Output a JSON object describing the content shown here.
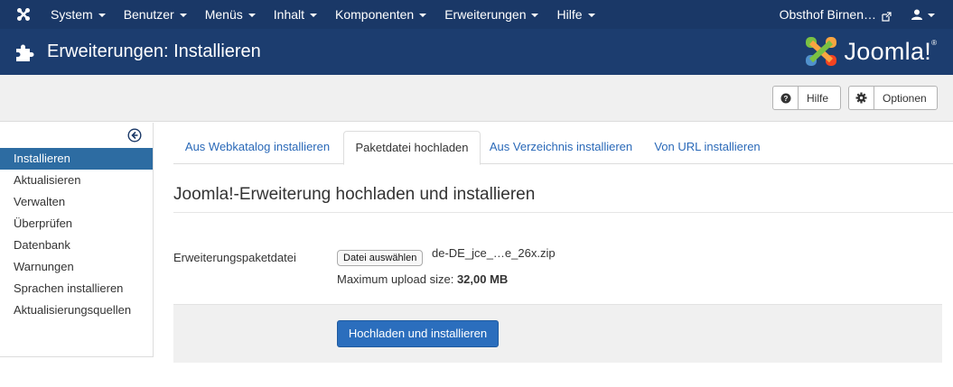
{
  "topnav": {
    "menu": [
      {
        "label": "System"
      },
      {
        "label": "Benutzer"
      },
      {
        "label": "Menüs"
      },
      {
        "label": "Inhalt"
      },
      {
        "label": "Komponenten"
      },
      {
        "label": "Erweiterungen"
      },
      {
        "label": "Hilfe"
      }
    ],
    "site_link": "Obsthof Birnen…",
    "bar_color": "#1a3867"
  },
  "header": {
    "title": "Erweiterungen: Installieren",
    "brand": "Joomla!",
    "brand_reg": "®",
    "bg_color": "#1c3d6f"
  },
  "toolbar": {
    "help_label": "Hilfe",
    "options_label": "Optionen"
  },
  "sidebar": {
    "items": [
      {
        "label": "Installieren",
        "active": true
      },
      {
        "label": "Aktualisieren"
      },
      {
        "label": "Verwalten"
      },
      {
        "label": "Überprüfen"
      },
      {
        "label": "Datenbank"
      },
      {
        "label": "Warnungen"
      },
      {
        "label": "Sprachen installieren"
      },
      {
        "label": "Aktualisierungsquellen"
      }
    ],
    "active_color": "#2d6ca2"
  },
  "tabs": [
    {
      "label": "Aus Webkatalog installieren"
    },
    {
      "label": "Paketdatei hochladen",
      "active": true
    },
    {
      "label": "Aus Verzeichnis installieren"
    },
    {
      "label": "Von URL installieren"
    }
  ],
  "main": {
    "legend": "Joomla!-Erweiterung hochladen und installieren",
    "field_label": "Erweiterungspaketdatei",
    "file_button": "Datei auswählen",
    "file_name": "de-DE_jce_…e_26x.zip",
    "max_size_prefix": "Maximum upload size: ",
    "max_size_value": "32,00 MB",
    "submit_label": "Hochladen und installieren",
    "accent_color": "#2b6ebd"
  }
}
